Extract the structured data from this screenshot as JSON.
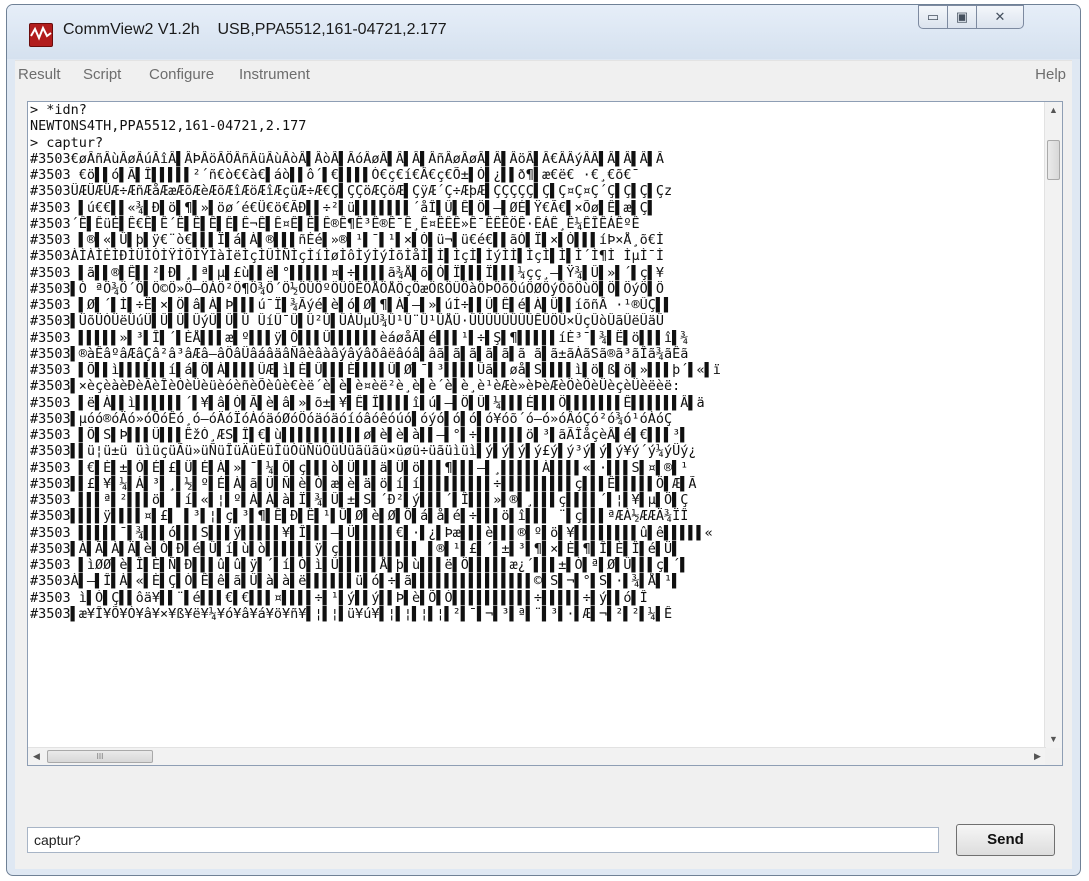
{
  "window": {
    "app_name": "CommView2 V1.2h",
    "connection": "USB,PPA5512,161-04721,2.177",
    "minimize_glyph": "▭",
    "maximize_glyph": "▣",
    "close_glyph": "✕"
  },
  "menu": {
    "items": [
      "Result",
      "Script",
      "Configure",
      "Instrument"
    ],
    "help": "Help"
  },
  "console": {
    "lines": [
      "> *idn?",
      "NEWTONS4TH,PPA5512,161-04721,2.177",
      "> captur?",
      "#3503€øÂñÂùÂøÂúÂîÂ▌ÂÞÂöÂÖÂñÂüÂùÂòÂ▌ÂòÂ▌ÂóÂøÂ▌Â▌Â▌ÂñÂøÂøÂ▌Â▌ÂöÂ▌Â€ÂÂýÂÂ▌Â▌Â▌Â▌Â",
      "#3503 €ö▌▌ó▌Ã▌Î▌▌▌▌▌²´ñ€ò€€à€▌áò▌▌ô´▌€▌▌▌▌Ò€ç€í€Â€ç€Õ±▌Ó▌¿▌▌ð¶▌æ€ë€ ·€¸€õ€¯",
      "#3503ÜÆÜÆÜÆ÷ÆñÆåÆæÆõÆèÆõÆîÆöÆîÆçüÆ÷Æ€Ç▌ÇÇöÆÇöÆ▌ÇÿÆ´Ç÷ÆþÆ▌ÇÇÇÇÇ▌Ç▌Ç¤Ç¤Ç´Ç▌Ç▌Ç▌Çz",
      "#3503 ▌ú€€▌▌«¾▌Ð▌ö▌¶▌»▌öø´é€Ü€ö€ÃÐ▌▌÷²▌ü▌▌▌▌▌▌▌´åÎ▌Û▌Ê▌Ö▌–▌ØÉ▌Ÿ€Ã€▌×Õø▌Ê▌æ▌Ç▌",
      "#3503´Ê▌ÊüÉ▌Ê€Ê▌Ê´Ê▌Ê▌Ê▌Ê▌Ê¬Ê▌Ê¤Ê▌Ê▌Ê®Ê¶Ê³Ê®Ê¯Ê¸Ê¤ÊÊÊ»Ê¯ÊÊÊÖÊ·ÊÁÊ¸Ê¼ÊÎÊÁÊºÊ",
      "#3503 ▌®▌«▌Û▌þ▌ÿ€¨ò€▌▌▌Ï▌á▌À▌®▌▌▌ñÈé▌»®▌¹▌¯▌¹▌×▌Ó▌ü¬▌ü€é€▌▌ãÓ▌Ï▌×▌Ó▌▌▌íÞ×Å¸õ€Ì",
      "#3503ÀÌÀÌÈÌÐÌÜÌÒÌŸÌÕÌŸÌàÌëÌçÌÛÌÑÌçÌíÌøÌôÌýÌýÌõÌåÌ▌Ì▌ÌçÌ▌ÌýÌÌ▌ÌçÌ▌Ì▌Ì´Ì¶Ì ÌµÌ¯Ì",
      "#3503 ▌ã▌▌®▌Ê▌▌²▌Ð▌¸▌ª▌µ▌£ù▌▌ë▌°▌▌▌▌▌¤▌÷▌▌▌▌ã¾Å▌õ▌Ó▌Ï▌▌▌Ï▌▌▌¼çç¸–▌Ÿ¾▌Û▌»▌´▌ç▌¥",
      "#3503▌Ó ªÖ¾Ö´Ö▌Ö©Ö»Ö–ÖÁÖ²Ö¶Ö¾Ö´Ö½ÖÛÖºÖÜÖÊÖÅÖÅÖçÖæÖßÖÛÖàÖÞÖõÖúÖØÖýÖõÖùÖ▌Ö▌ÖýÖ▌Ö",
      "#3503 ▌Ø▌´▌Ì▌÷Ë▌×▌Ö▌â▌À▌Þ▌▌▌ú¯Ï▌¾Ãýé▌è▌ó▌Ø▌¶▌À▌–▌»▌úÍ÷▌▌Û▌Ê▌é▌À▌Ü▌▌íõñÂ ·¹®ÛÇ▌▌",
      "#3503▌ÜõÜÒÜëÜúÜ▌Û▌Û▌ÛýÛ▌Û▌Û ÛíÛ¯Û▌Û²Û▌ÛÀÛµÛ¾Û¹Û¨Û¹ÛÅÛ·ÛÜÛÛÛÛÛÛÊÛÖÛ×ÛçÛòÛãÛëÛäÛ",
      "#3503 ▌▌▌▌▌»▌³▌Î▌´▌ÈÅ▌▌▌æ▌º▌▌▌ÿ▌Ô▌▌▌Û▌▌▌▌▌▌èáøåÃ▌é▌▌▌¹▌÷▌Ş▌¶▌▌▌▌▌íÈ³¯▌¾▌Ë▌ö▌▌▌î▌¾",
      "#3503▌®àÊâºâÆâÇâ²â³âÆâ–âÖâÜâáâäâÑâèâàâýâýâðâëâóâ▌âã▌ã▌ã▌ã▌ã▌ã ã▌ã±ãÀãSã®ã³ãÎã¾ãÊã",
      "#3503 ▌Õ▌▌ì▌▌▌▌▌▌í▌á▌Ö▌À▌▌▌▌ÛÆ▌ì▌È▌Û▌▌▌È▌▌▌▌Û▌Ø▌¯▌³▌▌▌▌Ûã▌▌øå▌S▌▌▌▌ì▌ö▌ß▌ö▌»▌▌▌þ´▌«▌ï",
      "#3503▌×èçèàèÐèÃèÎèÓèÜèüèóèñèÕèûè€èë´è▌è▌è¤èë²è¸è▌è´è▌è¸è¹èÆè»èÞèÆèÖèÖèÜèçèÜèëèë:",
      "#3503 ▌ë▌À▌▌ì▌▌▌▌▌▌´▌¥▌â▌Ó▌Ã▌è▌â▌»▌õ±▌¥▌Ê▌Î▌▌▌▌î▌ú▌–▌Ö▌Û▌¼▌▌▌É▌▌▌Ö▌▌▌▌▌▌▌Ê▌▌▌▌▌▌Â▌ä",
      "#3503▌µóó®óÄó»óÕóÊó¸ó–óÄóÏóÀóäóØóÖóäóäóíóâóêóúó▌óýó▌ó▌ó▌ó¥óõ´ó–ó»óÂóÇó²ó¾ó¹óÀóÇ",
      "#3503 ▌Õ▌S▌Þ▌▌▌Ü▌▌▌ÊžÓ¸ÆS▌Î▌€▌ù▌▌▌▌▌▌▌▌▌▌ø▌è▌è▌à▌▌–▌°▌÷▌▌▌▌▌▌ö▌³▌ãÃÎåçèÂ▌é▌€▌▌▌³▌",
      "#3503▌▌ü¦ü±ü üìüçüÃü»üÑüÎüÄüÈüÎüÒüÑüÔüÙüãüãü×üøü÷üãüìüì▌ý▌ý▌ý▌ý£ý▌ý³ý▌ý▌ý¥ý´ý¼ýÜý¿",
      "#3503 ▌€▌È▌±▌Ò▌É▌£▌Ü▌É▌À▌»▌¯▌¼▌Ô▌ç▌▌▌ò▌Ü▌▌▌ä▌Ü▌ö▌▌▌¶▌▌▌–▌¸▌▌▌▌▌À▌▌▌▌«▌·▌▌▌S▌¤▌®▌¹",
      "#3503▌▌£▌¥▌¼▌Á▌³▌¸▌½▌º▌É▌À▌ã▌Ü▌Ñ▌è▌Ó▌æ▌è▌ä▌ö▌í▌í▌▌▌▌▌▌▌▌▌÷▌▌▌▌▌▌▌▌▌ç▌▌▌Ê▌▌▌▌▌Ö▌Æ▌Ã",
      "#3503 ▌▌▌ª▌²▌▌▌ö▌ ▌í▌«▌¦▌º▌À▌À▌à▌Ï▌¾▌Û▌±▌S▌´Ð²▌ý▌▌▌´▌Î▌▌▌»▌®▌¸▌▌▌ç▌▌▌▌´▌¦▌¥▌µ▌Ö▌Ç",
      "#3503▌▌▌▌ÿ▌▌▌▌¤▌£▌ ▌³▌¦▌ç▌³▌¶▌Ê▌Ð▌Ê▌¹▌Û▌Ø▌è▌Ø▌Õ▌á▌å▌é▌÷▌▌▌ö▌î▌▌▌ ¨▌ç▌▌▌ªÆÀ½ÆÆÄ¾ÏÎ",
      "#3503 ▌▌▌▌▌¯▌¾▌▌▌ó▌▌▌S▌▌▌ÿ▌▌▌▌▌¥▌Î▌▌▌–▌Ü▌▌▌▌▌€▌·▌¿▌Þæ▌▌▌è▌▌▌®▌º▌ö▌¥▌▌▌▌▌▌▌▌û▌ê▌▌▌▌▌«",
      "#3503▌À▌Ã▌À▌Ä▌è▌Ò▌Ð▌é▌Û▌í▌ù▌ò▌▌▌▌▌▌ÿ▌ç▌▌▌▌▌▌▌▌▌▌ ▌®▌¹▌£▌´▌±▌³▌¶▌×▌È▌¶▌Î▌È▌Î▌é▌Ü▌",
      "#3503 ▌ìØØ▌è▌Î▌È▌Ñ▌Ð▌▌▌û▌û▌ÿ▌´▌í▌Ó▌ì▌Û▌▌▌▌▌Å▌þ▌ù▌▌▌ë▌Ö▌▌▌▌▌æ¿´▌▌▌±▌Ò▌ª▌Ø▌Û▌▌▌ç▌´▌",
      "#3503À▌–▌Î▌À▌«▌È▌Ç▌Ò▌Ê▌ê▌ã▌Û▌à▌à▌ë▌▌▌▌▌▌ü▌ó▌÷▌ã▌▌▌▌▌▌▌▌▌▌▌▌▌▌▌©▌S▌¬▌°▌S▌·▌¾▌Å▌¹▌",
      "#3503 ì▌Ó▌Ç▌▌ôä¥▌▌¨▌é▌▌▌€▌€▌▌▌¤▌▌▌▌÷▌¹▌ý▌▌ý▌▌Þ▌è▌Õ▌Ó▌▌▌▌▌▌▌▌▌▌÷▌▌▌▌▌÷▌ý▌▌ó▌Î",
      "#3503▌æ¥Î¥Õ¥Ó¥â¥×¥ß¥ë¥¼¥ó¥â¥á¥ö¥ñ¥▌¦▌¦▌ü¥ú¥▌¦▌¦▌¦▌¦▌²▌¯▌¬▌³▌ª▌¨▌³▌·▌Æ▌¬▌²▌²▌¼▌Ê"
    ]
  },
  "command": {
    "value": "captur?",
    "send_label": "Send"
  },
  "scrollbar": {
    "up_glyph": "▲",
    "down_glyph": "▼",
    "left_glyph": "◀",
    "right_glyph": "▶",
    "grip": "III"
  }
}
